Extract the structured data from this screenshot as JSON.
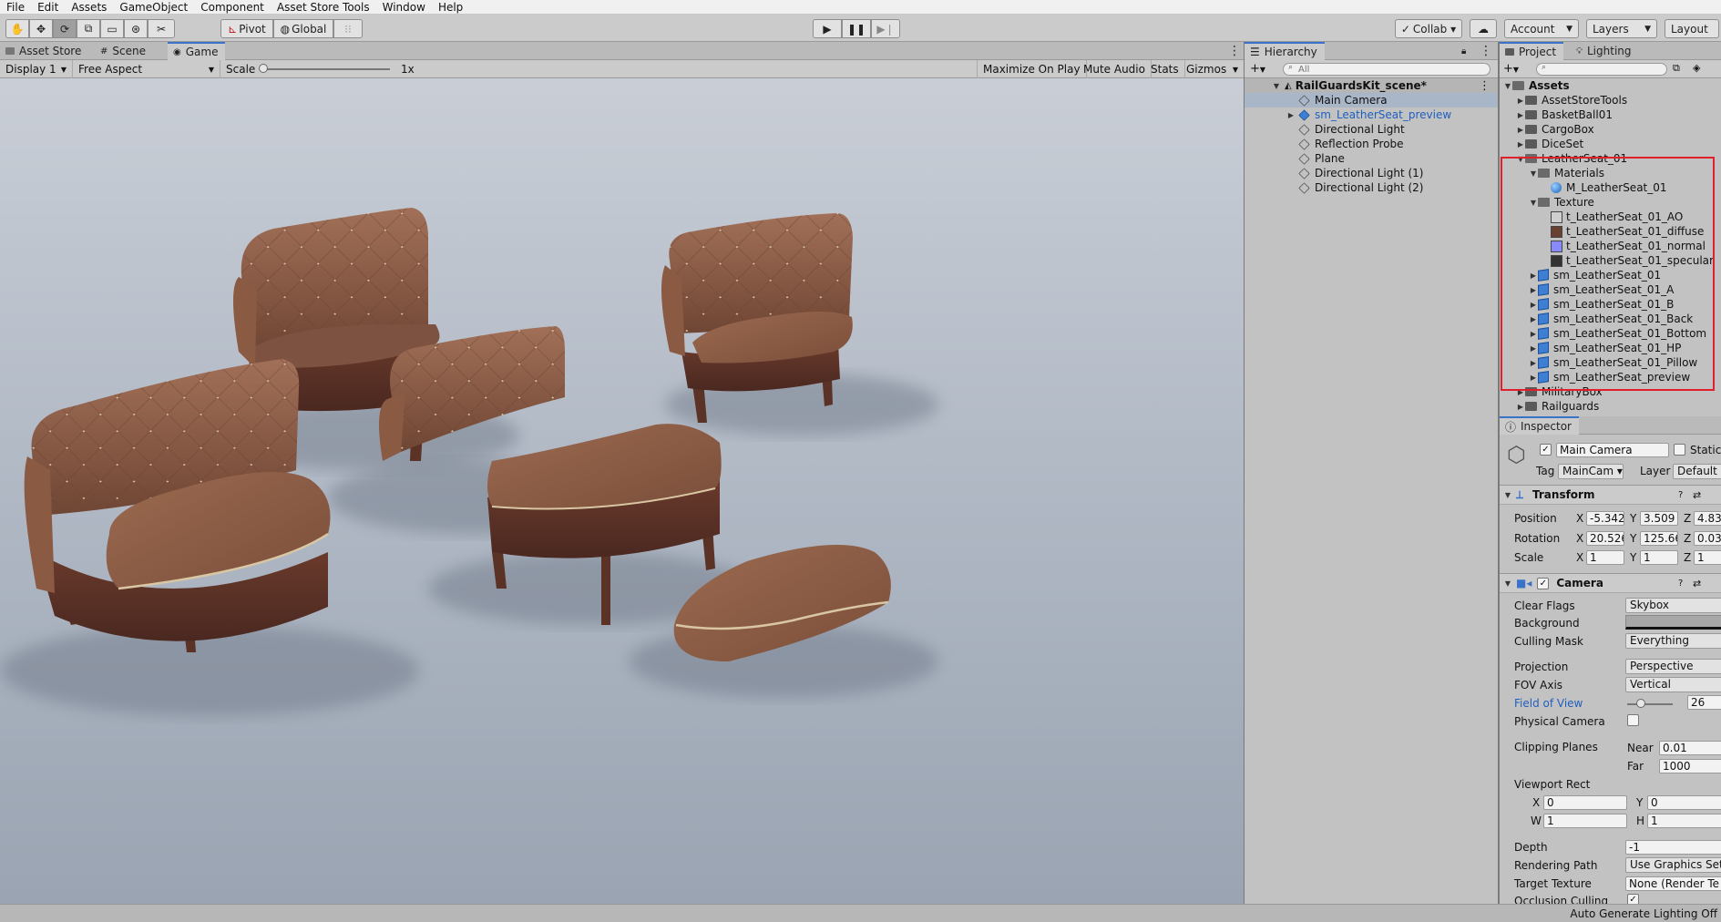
{
  "menu": [
    "File",
    "Edit",
    "Assets",
    "GameObject",
    "Component",
    "Asset Store Tools",
    "Window",
    "Help"
  ],
  "toolbar": {
    "pivot_label": "Pivot",
    "global_label": "Global",
    "collab_label": "Collab ▾",
    "account_label": "Account",
    "layers_label": "Layers",
    "layout_label": "Layout"
  },
  "scene_tabs": [
    "Asset Store",
    "Scene",
    "Game"
  ],
  "game_bar": {
    "display": "Display 1",
    "aspect": "Free Aspect",
    "scale_label": "Scale",
    "scale_value": "1x",
    "maximize": "Maximize On Play",
    "mute": "Mute Audio",
    "stats": "Stats",
    "gizmos": "Gizmos"
  },
  "hierarchy": {
    "title": "Hierarchy",
    "search_placeholder": "All",
    "scene_name": "RailGuardsKit_scene*",
    "items": [
      "Main Camera",
      "sm_LeatherSeat_preview",
      "Directional Light",
      "Reflection Probe",
      "Plane",
      "Directional Light (1)",
      "Directional Light (2)"
    ]
  },
  "project": {
    "tabs": [
      "Project",
      "Lighting"
    ],
    "root": "Assets",
    "rows": [
      {
        "label": "AssetStoreTools",
        "icon": "folder-icon"
      },
      {
        "label": "BasketBall01",
        "icon": "folder-icon"
      },
      {
        "label": "CargoBox",
        "icon": "folder-icon"
      },
      {
        "label": "DiceSet",
        "icon": "folder-icon"
      },
      {
        "label": "LeatherSeat_01",
        "icon": "folder-open-icon"
      },
      {
        "label": "Materials",
        "icon": "folder-open-icon"
      },
      {
        "label": "M_LeatherSeat_01",
        "icon": "material-sphere-icon"
      },
      {
        "label": "Texture",
        "icon": "folder-open-icon"
      },
      {
        "label": "t_LeatherSeat_01_AO",
        "icon": "texture-icon"
      },
      {
        "label": "t_LeatherSeat_01_diffuse",
        "icon": "texture-icon"
      },
      {
        "label": "t_LeatherSeat_01_normal",
        "icon": "texture-icon"
      },
      {
        "label": "t_LeatherSeat_01_specular",
        "icon": "texture-icon"
      },
      {
        "label": "sm_LeatherSeat_01",
        "icon": "mesh-icon"
      },
      {
        "label": "sm_LeatherSeat_01_A",
        "icon": "mesh-icon"
      },
      {
        "label": "sm_LeatherSeat_01_B",
        "icon": "mesh-icon"
      },
      {
        "label": "sm_LeatherSeat_01_Back",
        "icon": "mesh-icon"
      },
      {
        "label": "sm_LeatherSeat_01_Bottom",
        "icon": "mesh-icon"
      },
      {
        "label": "sm_LeatherSeat_01_HP",
        "icon": "mesh-icon"
      },
      {
        "label": "sm_LeatherSeat_01_Pillow",
        "icon": "mesh-icon"
      },
      {
        "label": "sm_LeatherSeat_preview",
        "icon": "mesh-icon"
      },
      {
        "label": "MilitaryBox",
        "icon": "folder-icon"
      },
      {
        "label": "Railguards",
        "icon": "folder-icon"
      }
    ],
    "highlight_color": "#e0202a"
  },
  "inspector": {
    "title": "Inspector",
    "object_name": "Main Camera",
    "static_label": "Static",
    "tag_label": "Tag",
    "tag_value": "MainCam",
    "layer_label": "Layer",
    "layer_value": "Default",
    "transform": {
      "title": "Transform",
      "position": {
        "label": "Position",
        "x": "-5.342",
        "y": "3.509",
        "z": "4.83"
      },
      "rotation": {
        "label": "Rotation",
        "x": "20.526",
        "y": "125.66",
        "z": "0.03"
      },
      "scale": {
        "label": "Scale",
        "x": "1",
        "y": "1",
        "z": "1"
      }
    },
    "camera": {
      "title": "Camera",
      "clear_flags": {
        "label": "Clear Flags",
        "value": "Skybox"
      },
      "background": {
        "label": "Background"
      },
      "culling_mask": {
        "label": "Culling Mask",
        "value": "Everything"
      },
      "projection": {
        "label": "Projection",
        "value": "Perspective"
      },
      "fov_axis": {
        "label": "FOV Axis",
        "value": "Vertical"
      },
      "field_of_view": {
        "label": "Field of View",
        "value": "26"
      },
      "physical_camera": {
        "label": "Physical Camera"
      },
      "clipping_planes": {
        "label": "Clipping Planes",
        "near_label": "Near",
        "near": "0.01",
        "far_label": "Far",
        "far": "1000"
      },
      "viewport_rect": {
        "label": "Viewport Rect",
        "x": "0",
        "y": "0",
        "w": "1",
        "h": "1"
      },
      "depth": {
        "label": "Depth",
        "value": "-1"
      },
      "rendering_path": {
        "label": "Rendering Path",
        "value": "Use Graphics Set"
      },
      "target_texture": {
        "label": "Target Texture",
        "value": "None (Render Te"
      },
      "occlusion_culling": {
        "label": "Occlusion Culling"
      }
    }
  },
  "status": "Auto Generate Lighting Off",
  "colors": {
    "accent": "#3a72c9",
    "selection_text": "#1f5fbf",
    "leather": "#8a5a40"
  }
}
